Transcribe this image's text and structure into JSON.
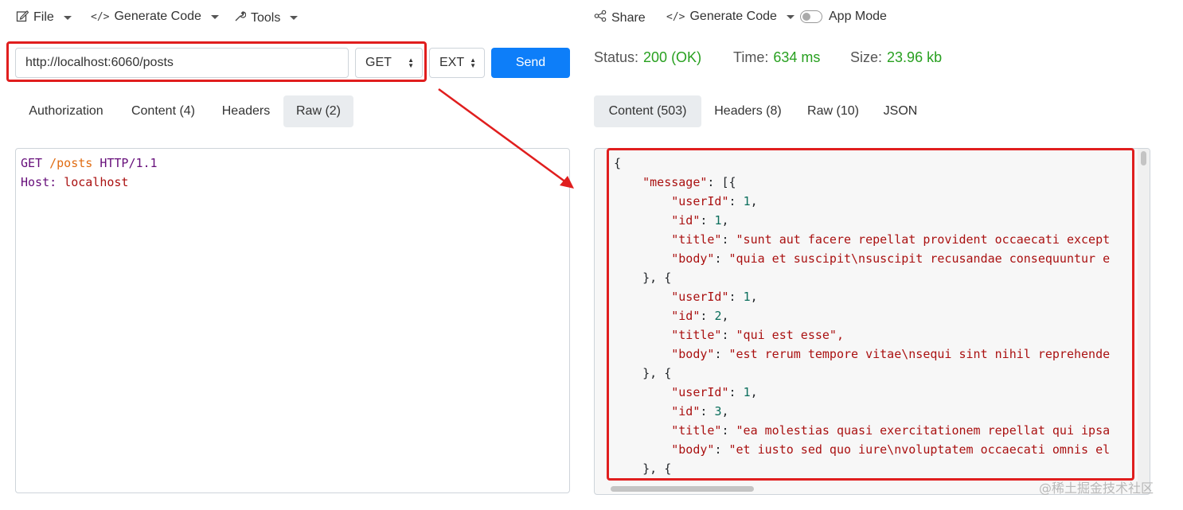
{
  "left_menu": {
    "file": "File",
    "generate_code": "Generate Code",
    "tools": "Tools"
  },
  "right_menu": {
    "share": "Share",
    "generate_code": "Generate Code",
    "app_mode": "App Mode"
  },
  "request": {
    "url": "http://localhost:6060/posts",
    "method": "GET",
    "ext": "EXT",
    "send": "Send"
  },
  "response_status": {
    "status_label": "Status:",
    "status_value": "200 (OK)",
    "time_label": "Time:",
    "time_value": "634 ms",
    "size_label": "Size:",
    "size_value": "23.96 kb"
  },
  "request_tabs": [
    "Authorization",
    "Content (4)",
    "Headers",
    "Raw (2)"
  ],
  "response_tabs": [
    "Content (503)",
    "Headers (8)",
    "Raw (10)",
    "JSON"
  ],
  "raw_request": {
    "line1_method": "GET",
    "line1_path": "/posts",
    "line1_proto": "HTTP/1.1",
    "line2_key": "Host:",
    "line2_value": "localhost"
  },
  "response_lines": [
    "{",
    "    \"message\": [{",
    "        \"userId\": 1,",
    "        \"id\": 1,",
    "        \"title\": \"sunt aut facere repellat provident occaecati except",
    "        \"body\": \"quia et suscipit\\nsuscipit recusandae consequuntur e",
    "    }, {",
    "        \"userId\": 1,",
    "        \"id\": 2,",
    "        \"title\": \"qui est esse\",",
    "        \"body\": \"est rerum tempore vitae\\nsequi sint nihil reprehende",
    "    }, {",
    "        \"userId\": 1,",
    "        \"id\": 3,",
    "        \"title\": \"ea molestias quasi exercitationem repellat qui ipsa",
    "        \"body\": \"et iusto sed quo iure\\nvoluptatem occaecati omnis el",
    "    }, {"
  ],
  "watermark": "@稀土掘金技术社区",
  "colors": {
    "accent": "#0d7ef9",
    "status_ok": "#28a020",
    "highlight": "#e01e1e"
  }
}
